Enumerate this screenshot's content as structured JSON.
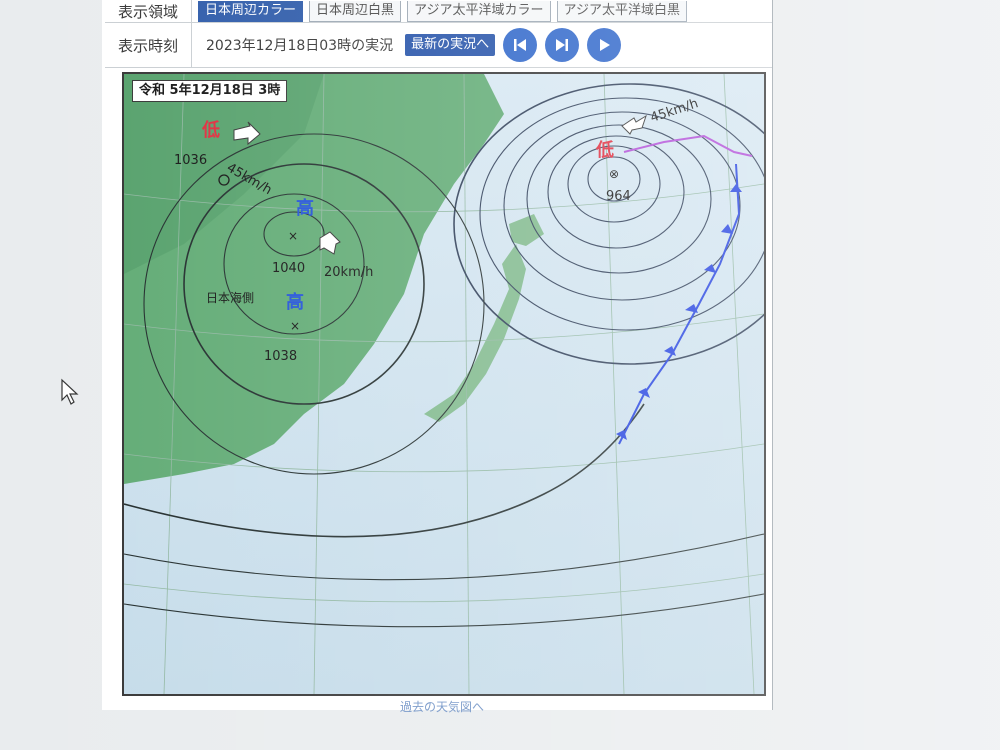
{
  "controls": {
    "area_label": "表示領域",
    "area_tabs": [
      "日本周辺カラー",
      "日本周辺白黒",
      "アジア太平洋域カラー",
      "アジア太平洋域白黒"
    ],
    "active_tab_index": 0,
    "time_label": "表示時刻",
    "time_text": "2023年12月18日03時の実況",
    "latest_button": "最新の実況へ",
    "nav_buttons": [
      "first-icon",
      "last-icon",
      "play-icon"
    ]
  },
  "map": {
    "date_label": "令和 5年12月18日 3時",
    "systems": [
      {
        "kind": "低",
        "pressure": "1036",
        "speed": "45km/h",
        "color": "#e0283a"
      },
      {
        "kind": "高",
        "pressure": "1040",
        "speed": "20km/h",
        "color": "#1e4fd8"
      },
      {
        "kind": "高",
        "pressure": "1038",
        "color": "#1e4fd8"
      },
      {
        "kind": "低",
        "pressure": "964",
        "speed": "45km/h",
        "color": "#e0283a"
      }
    ],
    "annotation": "日本海側"
  },
  "footer": {
    "past_link": "過去の天気図へ"
  },
  "colors": {
    "accent": "#2a58a8",
    "land_green": "#5faa73",
    "sea_blue": "#c9dfee",
    "low_red": "#e0283a",
    "high_blue": "#1e4fd8"
  }
}
